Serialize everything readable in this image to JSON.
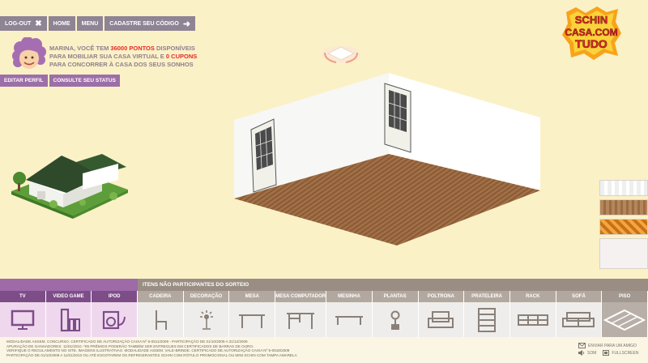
{
  "nav": {
    "logout": "Log-out",
    "home": "Home",
    "menu": "Menu",
    "register_code": "Cadastre seu código"
  },
  "user": {
    "msg_prefix": "Marina, você tem ",
    "points": "36000 pontos",
    "msg_mid": " disponíveis",
    "line2_a": "para mobiliar sua casa virtual e ",
    "coupons": "0 cupons",
    "line3": "para concorrer à casa dos seus sonhos",
    "edit_profile": "Editar perfil",
    "check_status": "Consulte seu status"
  },
  "logo": {
    "line1": "SCHIN",
    "line2": "CASA.COM",
    "line3": "TUDO"
  },
  "bottom": {
    "non_participating": "Itens não participantes do sorteio",
    "left_categories": [
      {
        "label": "TV",
        "icon": "tv-icon"
      },
      {
        "label": "Video game",
        "icon": "video-game-icon"
      },
      {
        "label": "iPod",
        "icon": "ipod-icon"
      }
    ],
    "right_categories": [
      {
        "label": "Cadeira",
        "icon": "chair-icon"
      },
      {
        "label": "Decoração",
        "icon": "lamp-icon"
      },
      {
        "label": "Mesa",
        "icon": "table-icon"
      },
      {
        "label": "Mesa computador",
        "icon": "desk-icon"
      },
      {
        "label": "Mesinha",
        "icon": "coffee-table-icon"
      },
      {
        "label": "Plantas",
        "icon": "plant-icon"
      },
      {
        "label": "Poltrona",
        "icon": "armchair-icon"
      },
      {
        "label": "Prateleira",
        "icon": "shelf-icon"
      },
      {
        "label": "Rack",
        "icon": "rack-icon"
      },
      {
        "label": "Sofá",
        "icon": "sofa-icon"
      },
      {
        "label": "Piso",
        "icon": "floor-icon"
      }
    ],
    "selected": "Piso"
  },
  "footer": {
    "legal": [
      "Modalidade assem. concurso. certificado de autorização caixa nº 6-0511/2009 - participação de 01/10/2009 a 31/12/2009",
      "apuração de ganhadores: 11/01/2010. *05 prêmios poderão também ser entregues em certificados de barras de ouro.",
      "verifique o regulamento no site. imagens ilustrativas. modalidade assem. vale-brinde. certificado de autorização caixa nº 5-0518/2009",
      "participação de 01/10/2009 a 11/01/2010 ou até esgotarem os refrigerantes schin com rótulo promocional ou mini schin com tampa amarela"
    ],
    "send_friend": "Enviar para um amigo",
    "sound": "Som",
    "fullscreen": "Fullscreen"
  },
  "colors": {
    "background": "#fbf1c6",
    "nav": "#8e8494",
    "purple": "#9e6aa8",
    "points_red": "#e4292a",
    "taupe": "#9a8e84"
  }
}
